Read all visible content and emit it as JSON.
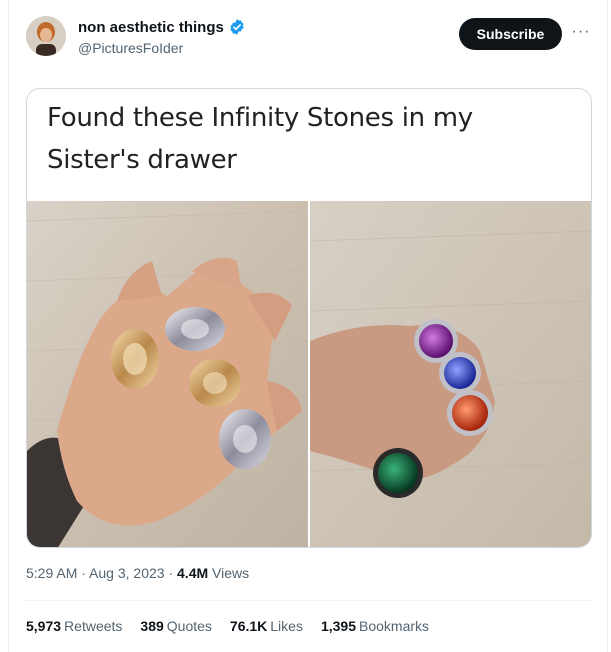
{
  "author": {
    "display_name": "non aesthetic things",
    "handle": "@PicturesFoIder",
    "verified_icon": "verified-badge-icon"
  },
  "header": {
    "subscribe_label": "Subscribe",
    "more_label": "···"
  },
  "media": {
    "caption_line1": "Found these Infinity Stones in my",
    "caption_line2": "Sister's drawer"
  },
  "meta": {
    "time": "5:29 AM",
    "sep1": " · ",
    "date": "Aug 3, 2023",
    "sep2": " · ",
    "views_count": "4.4M",
    "views_label": " Views"
  },
  "stats": [
    {
      "count": "5,973",
      "label": "Retweets"
    },
    {
      "count": "389",
      "label": "Quotes"
    },
    {
      "count": "76.1K",
      "label": "Likes"
    },
    {
      "count": "1,395",
      "label": "Bookmarks"
    }
  ],
  "colors": {
    "verified": "#1d9bf0",
    "text_primary": "#0f1419",
    "text_secondary": "#536471",
    "stone_purple": "#8b1fa8",
    "stone_blue": "#2b3ed8",
    "stone_orange": "#e0481b",
    "stone_green": "#0f6b3e"
  }
}
